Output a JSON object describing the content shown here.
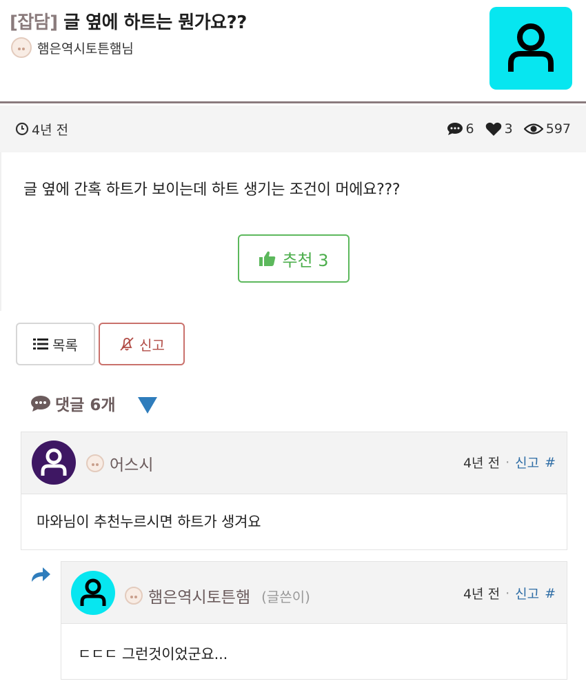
{
  "post": {
    "category": "[잡담]",
    "title": "글 옆에 하트는 뭔가요??",
    "author": "햄은역시토튼햄님",
    "time": "4년 전",
    "comments_count": "6",
    "likes_count": "3",
    "views_count": "597",
    "body": "글 옆에 간혹 하트가 보이는데 하트 생기는 조건이 머에요???",
    "recommend_label": "추천 3"
  },
  "actions": {
    "list_label": "목록",
    "report_label": "신고"
  },
  "comments_section": {
    "title": "댓글 6개"
  },
  "comments": [
    {
      "author": "어스시",
      "time": "4년 전",
      "report": "신고",
      "hash": "#",
      "text": "마와님이 추천누르시면 하트가 생겨요"
    },
    {
      "author": "햄은역시토튼햄",
      "tag": "(글쓴이)",
      "time": "4년 전",
      "report": "신고",
      "hash": "#",
      "text": "ㄷㄷㄷ 그런것이었군요..."
    }
  ],
  "colors": {
    "accent_cyan": "#07e6f0",
    "recommend_green": "#5cb85c",
    "report_red": "#c9706b",
    "link_blue": "#2f6ea6",
    "commenter_purple": "#3e1763"
  }
}
